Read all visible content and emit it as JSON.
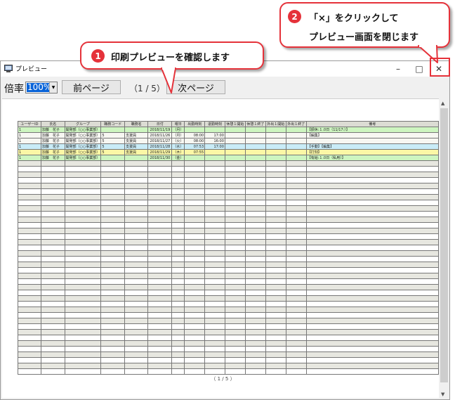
{
  "window": {
    "title": "プレビュー",
    "minimize_glyph": "–",
    "maximize_glyph": "□",
    "close_glyph": "✕"
  },
  "toolbar": {
    "zoom_label": "倍率",
    "zoom_value": "100%",
    "prev_label": "前ページ",
    "page_counter": "（1 / 5）",
    "next_label": "次ページ"
  },
  "preview": {
    "headers": [
      "ユーザーID",
      "氏名",
      "グループ",
      "職務コード",
      "職務名",
      "日付",
      "曜日",
      "出勤時刻",
      "退勤時刻",
      "休憩１開始",
      "休憩１終了",
      "外出１開始",
      "外出１終了",
      "備考"
    ],
    "rows": [
      {
        "style": "r-green",
        "cells": [
          "1",
          "加藤　花子",
          "開発部（○○事業部）",
          "",
          "",
          "2018/11/19",
          "（月）",
          "",
          "",
          "",
          "",
          "",
          "",
          "【振休:１.0日（11/17:）】"
        ]
      },
      {
        "style": "r-white",
        "cells": [
          "1",
          "加藤　花子",
          "開発部（○○事業部）",
          "5",
          "支援員",
          "2018/11/26",
          "（月）",
          "08:00",
          "17:00",
          "",
          "",
          "",
          "",
          "【編集】"
        ]
      },
      {
        "style": "r-white",
        "cells": [
          "1",
          "加藤　花子",
          "開発部（○○事業部）",
          "5",
          "支援員",
          "2018/11/27",
          "（火）",
          "08:00",
          "16:00",
          "",
          "",
          "",
          "",
          ""
        ]
      },
      {
        "style": "r-blue",
        "cells": [
          "1",
          "加藤　花子",
          "開発部（○○事業部）",
          "5",
          "支援員",
          "2018/11/28",
          "（水）",
          "07:53",
          "17:00",
          "",
          "",
          "",
          "",
          "【手動】【編集】"
        ]
      },
      {
        "style": "r-yellow",
        "cells": [
          "1",
          "加藤　花子",
          "開発部（○○事業部）",
          "5",
          "支援員",
          "2018/11/29",
          "（木）",
          "07:55",
          "",
          "",
          "",
          "",
          "",
          "【打刻】"
        ]
      },
      {
        "style": "r-green",
        "cells": [
          "1",
          "加藤　花子",
          "開発部（○○事業部）",
          "",
          "",
          "2018/11/30",
          "（金）",
          "",
          "",
          "",
          "",
          "",
          "",
          "【有給:１.0日（私用）】"
        ]
      }
    ],
    "footer": "（ 1 / 5 ）"
  },
  "callouts": {
    "one": {
      "number": "1",
      "text": "印刷プレビューを確認します"
    },
    "two": {
      "number": "2",
      "line1": "「×」をクリックして",
      "line2": "プレビュー画面を閉じます"
    }
  },
  "colors": {
    "accent_red": "#e5323a",
    "row_green": "#cdf5c0",
    "row_blue": "#c9ecf7",
    "row_yellow": "#fbf7a6",
    "header_gray": "#dcdcd4"
  }
}
